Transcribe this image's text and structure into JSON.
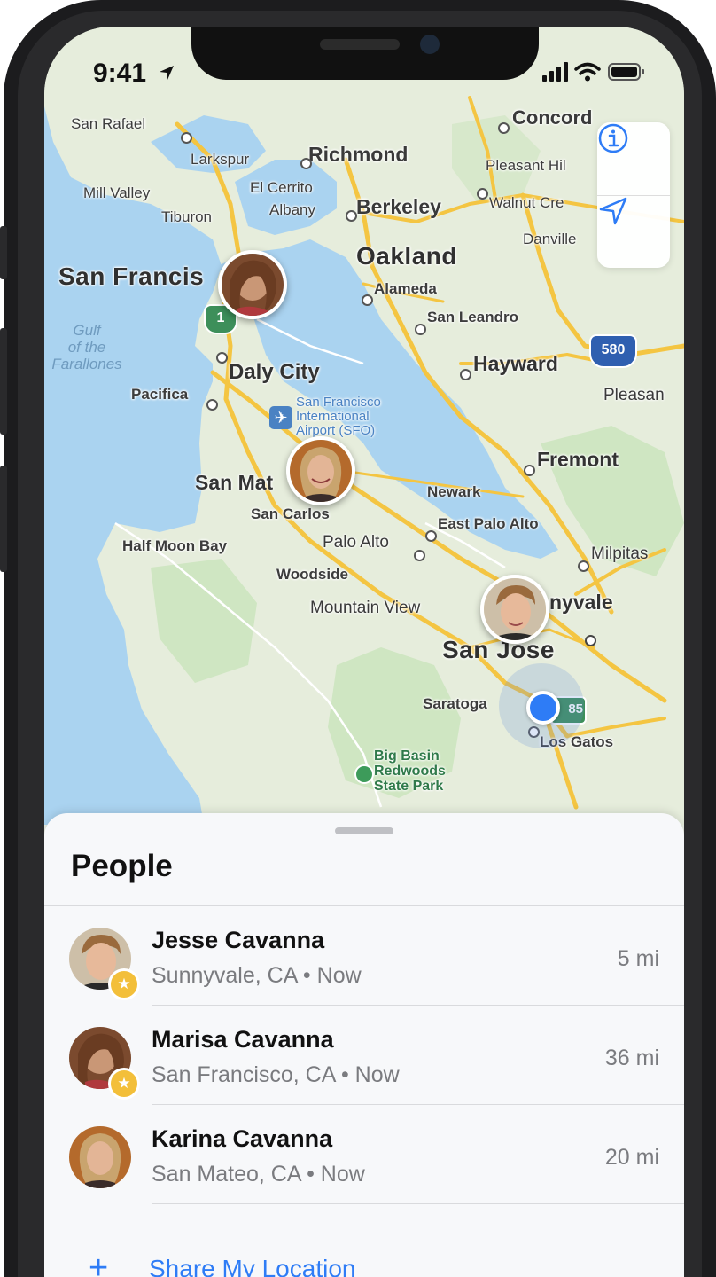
{
  "status_bar": {
    "time": "9:41"
  },
  "map": {
    "labels": {
      "san_rafael": "San Rafael",
      "concord": "Concord",
      "larkspur": "Larkspur",
      "richmond": "Richmond",
      "pleasant_hill": "Pleasant Hil",
      "mill_valley": "Mill Valley",
      "el_cerrito": "El Cerrito",
      "albany": "Albany",
      "berkeley": "Berkeley",
      "walnut_creek": "Walnut Cre",
      "tiburon": "Tiburon",
      "danville": "Danville",
      "san_francisco": "San Francis",
      "oakland": "Oakland",
      "alameda": "Alameda",
      "san_leandro": "San Leandro",
      "gulf": "Gulf\nof the\nFarallones",
      "hwy_1": "1",
      "hwy_580": "580",
      "hwy_85": "85",
      "daly_city": "Daly City",
      "hayward": "Hayward",
      "pleasanton": "Pleasan",
      "pacifica": "Pacifica",
      "sfo": "San Francisco\nInternational\nAirport (SFO)",
      "fremont": "Fremont",
      "san_mateo": "San Mat",
      "newark": "Newark",
      "san_carlos": "San Carlos",
      "east_palo_alto": "East Palo Alto",
      "half_moon_bay": "Half Moon Bay",
      "palo_alto": "Palo Alto",
      "milpitas": "Milpitas",
      "woodside": "Woodside",
      "mountain_view": "Mountain View",
      "sunnyvale": "nyvale",
      "san_jose": "San Jose",
      "saratoga": "Saratoga",
      "los_gatos": "Los Gatos",
      "big_basin": "Big Basin\nRedwoods\nState Park"
    },
    "buttons": {
      "info_icon": "info-icon",
      "location_icon": "location-arrow-icon"
    },
    "colors": {
      "water": "#aad3f0",
      "land": "#e6eddc",
      "park": "#cfe6c2",
      "road": "#f4c542",
      "accent": "#2e7cf6"
    }
  },
  "people": {
    "title": "People",
    "items": [
      {
        "name": "Jesse Cavanna",
        "location": "Sunnyvale, CA • Now",
        "distance": "5 mi",
        "favorite": true
      },
      {
        "name": "Marisa Cavanna",
        "location": "San Francisco, CA • Now",
        "distance": "36 mi",
        "favorite": true
      },
      {
        "name": "Karina Cavanna",
        "location": "San Mateo, CA • Now",
        "distance": "20 mi",
        "favorite": false
      }
    ],
    "share_label": "Share My Location"
  }
}
